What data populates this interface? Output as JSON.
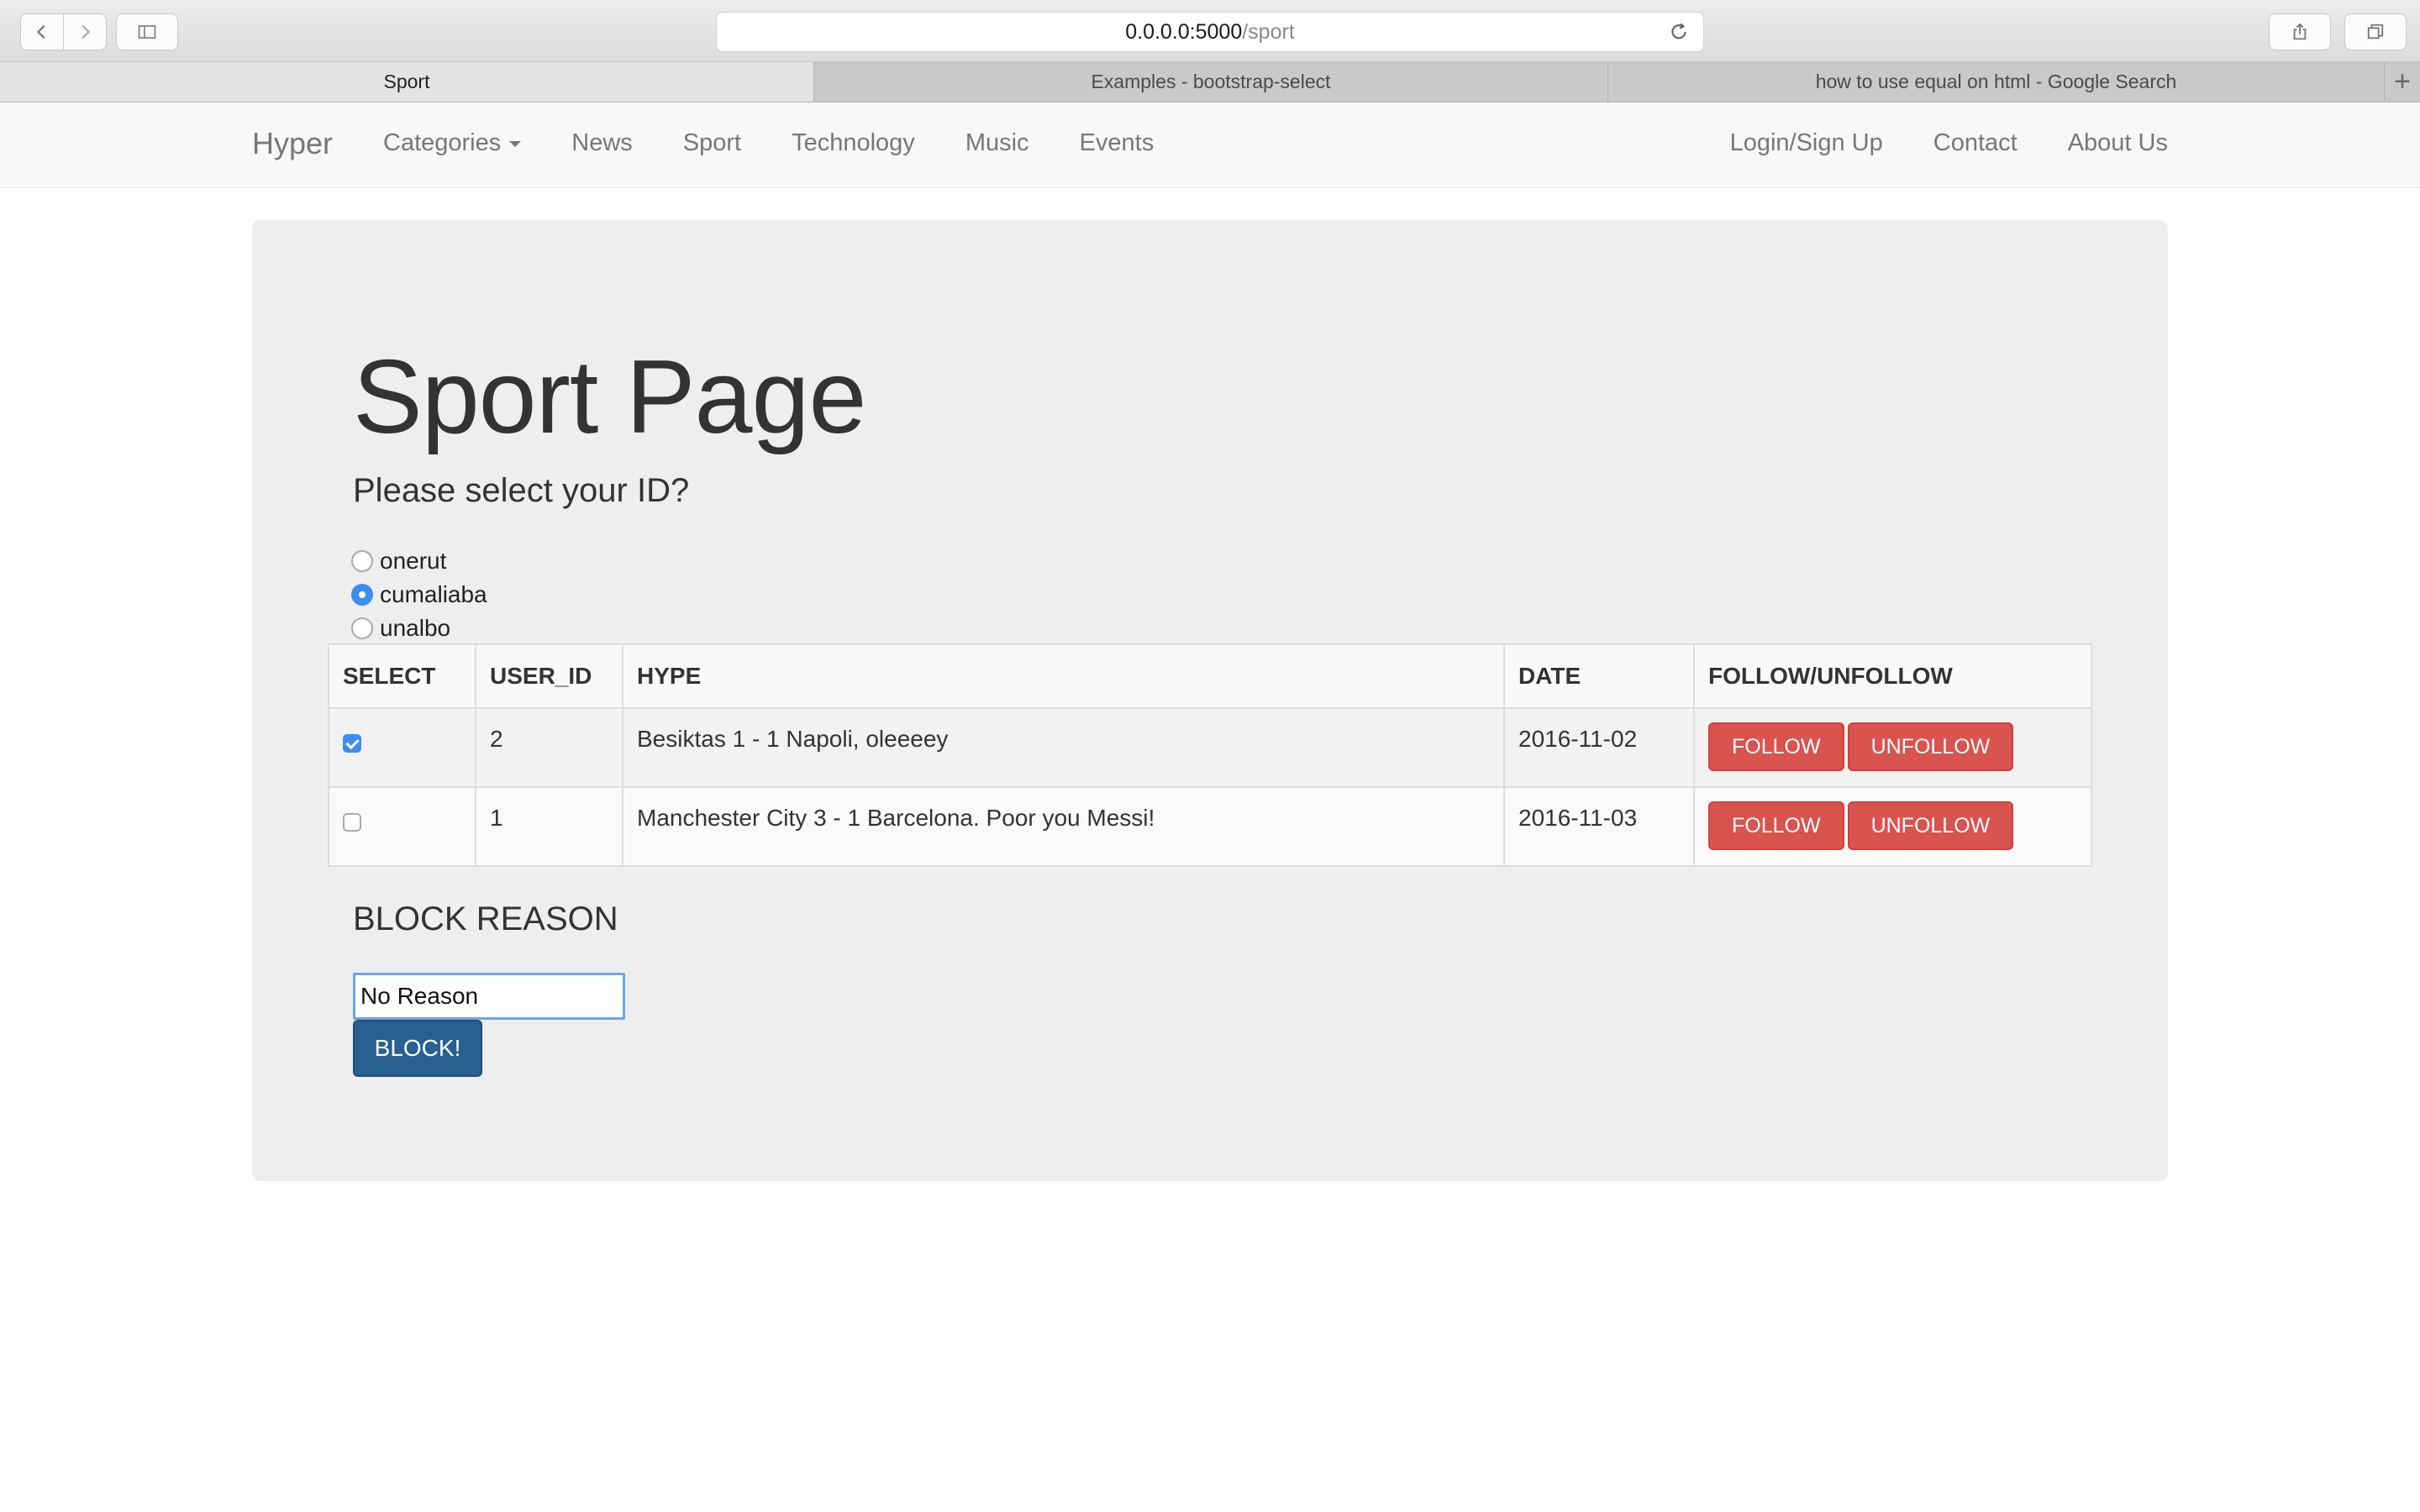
{
  "browser": {
    "url_host": "0.0.0.0:5000",
    "url_path": "/sport",
    "tabs": [
      {
        "label": "Sport",
        "active": true
      },
      {
        "label": "Examples - bootstrap-select",
        "active": false
      },
      {
        "label": "how to use equal on html - Google Search",
        "active": false
      }
    ],
    "new_tab_label": "+"
  },
  "navbar": {
    "brand": "Hyper",
    "left_items": [
      "Categories",
      "News",
      "Sport",
      "Technology",
      "Music",
      "Events"
    ],
    "right_items": [
      "Login/Sign Up",
      "Contact",
      "About Us"
    ]
  },
  "main": {
    "title": "Sport Page",
    "subtitle": "Please select your ID?",
    "ids": [
      {
        "label": "onerut",
        "checked": false
      },
      {
        "label": "cumaliaba",
        "checked": true
      },
      {
        "label": "unalbo",
        "checked": false
      }
    ],
    "table": {
      "headers": [
        "SELECT",
        "USER_ID",
        "HYPE",
        "DATE",
        "FOLLOW/UNFOLLOW"
      ],
      "rows": [
        {
          "checked": true,
          "user_id": "2",
          "hype": "Besiktas 1 - 1 Napoli, oleeeey",
          "date": "2016-11-02"
        },
        {
          "checked": false,
          "user_id": "1",
          "hype": "Manchester City 3 - 1 Barcelona. Poor you Messi!",
          "date": "2016-11-03"
        }
      ],
      "follow_label": "FOLLOW",
      "unfollow_label": "UNFOLLOW"
    },
    "block_reason_label": "BLOCK REASON",
    "block_reason_value": "No Reason",
    "block_button": "BLOCK!"
  },
  "colors": {
    "danger": "#d9534f",
    "primary": "#286090",
    "accent": "#3b8df0"
  }
}
